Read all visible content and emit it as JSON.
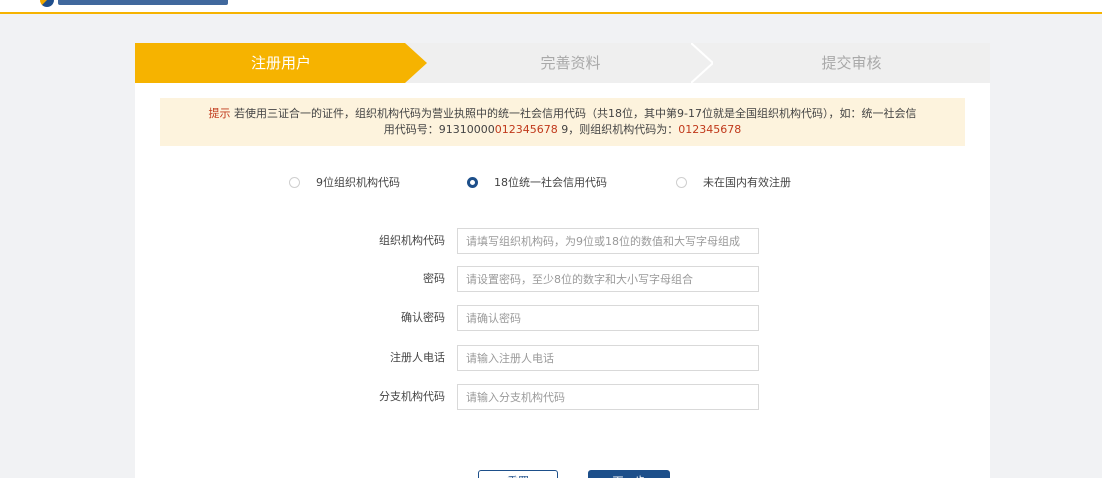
{
  "steps": [
    {
      "label": "注册用户",
      "active": true
    },
    {
      "label": "完善资料",
      "active": false
    },
    {
      "label": "提交审核",
      "active": false
    }
  ],
  "notice": {
    "prefix": "提示",
    "text1": " 若使用三证合一的证件，组织机构代码为营业执照中的统一社会信用代码（共18位，其中第9-17位就是全国组织机构代码），如：统一社会信",
    "text2a": "用代码号：91310000",
    "text2b": "012345678",
    "text2c": " 9，则组织机构代码为：",
    "text2d": "012345678"
  },
  "radios": [
    {
      "label": "9位组织机构代码",
      "checked": false
    },
    {
      "label": "18位统一社会信用代码",
      "checked": true
    },
    {
      "label": "未在国内有效注册",
      "checked": false
    }
  ],
  "fields": {
    "org_code": {
      "label": "组织机构代码",
      "placeholder": "请填写组织机构码，为9位或18位的数值和大写字母组成"
    },
    "password": {
      "label": "密码",
      "placeholder": "请设置密码，至少8位的数字和大小写字母组合"
    },
    "confirm_password": {
      "label": "确认密码",
      "placeholder": "请确认密码"
    },
    "phone": {
      "label": "注册人电话",
      "placeholder": "请输入注册人电话"
    },
    "branch_code": {
      "label": "分支机构代码",
      "placeholder": "请输入分支机构代码"
    }
  },
  "buttons": {
    "reset": "重置",
    "next": "下一步"
  },
  "colors": {
    "accent": "#f6b300",
    "primary": "#1d4f8a",
    "notice_bg": "#fdf3dd",
    "highlight": "#c0391b"
  }
}
